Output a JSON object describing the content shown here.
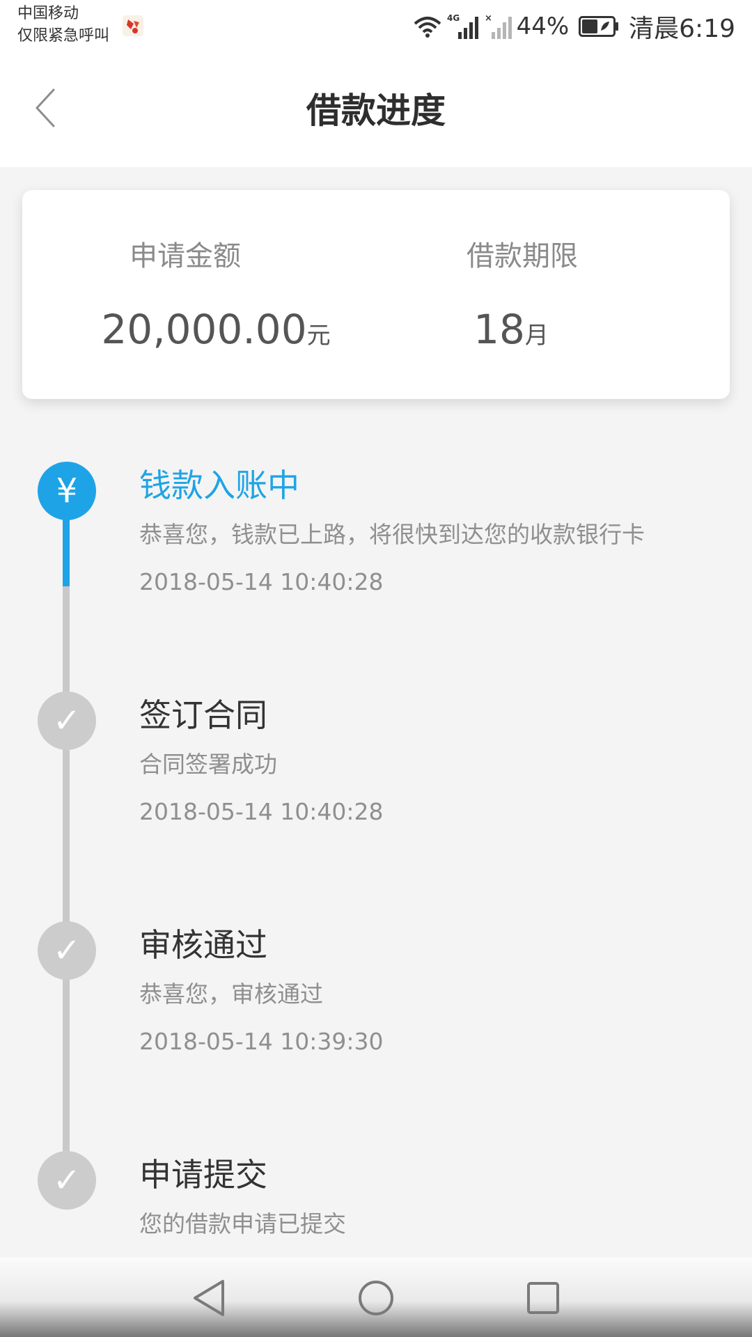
{
  "status_bar": {
    "carrier": "中国移动",
    "carrier_note": "仅限紧急呼叫",
    "network_type": "4G",
    "battery_percent": "44%",
    "time": "清晨6:19",
    "icons": [
      "app-notification-icon",
      "wifi-icon",
      "signal-4g-icon",
      "signal-no-sim-icon",
      "battery-icon"
    ]
  },
  "header": {
    "title": "借款进度",
    "back_icon": "chevron-left-icon"
  },
  "summary": {
    "amount_label": "申请金额",
    "amount_value": "20,000.00",
    "amount_unit": "元",
    "term_label": "借款期限",
    "term_value": "18",
    "term_unit": "月"
  },
  "timeline": {
    "steps": [
      {
        "title": "钱款入账中",
        "desc": "恭喜您，钱款已上路，将很快到达您的收款银行卡",
        "time": "2018-05-14 10:40:28",
        "icon": "yuan-icon",
        "glyph": "¥",
        "state": "active"
      },
      {
        "title": "签订合同",
        "desc": "合同签署成功",
        "time": "2018-05-14 10:40:28",
        "icon": "check-icon",
        "glyph": "✓",
        "state": "done"
      },
      {
        "title": "审核通过",
        "desc": "恭喜您，审核通过",
        "time": "2018-05-14 10:39:30",
        "icon": "check-icon",
        "glyph": "✓",
        "state": "done"
      },
      {
        "title": "申请提交",
        "desc": "您的借款申请已提交",
        "time": "",
        "icon": "check-icon",
        "glyph": "✓",
        "state": "done"
      }
    ]
  },
  "system_nav": {
    "icons": [
      "nav-back-icon",
      "nav-home-icon",
      "nav-recents-icon"
    ]
  },
  "colors": {
    "accent": "#1ea4e6",
    "inactive": "#cccccc",
    "background": "#f4f4f4"
  }
}
